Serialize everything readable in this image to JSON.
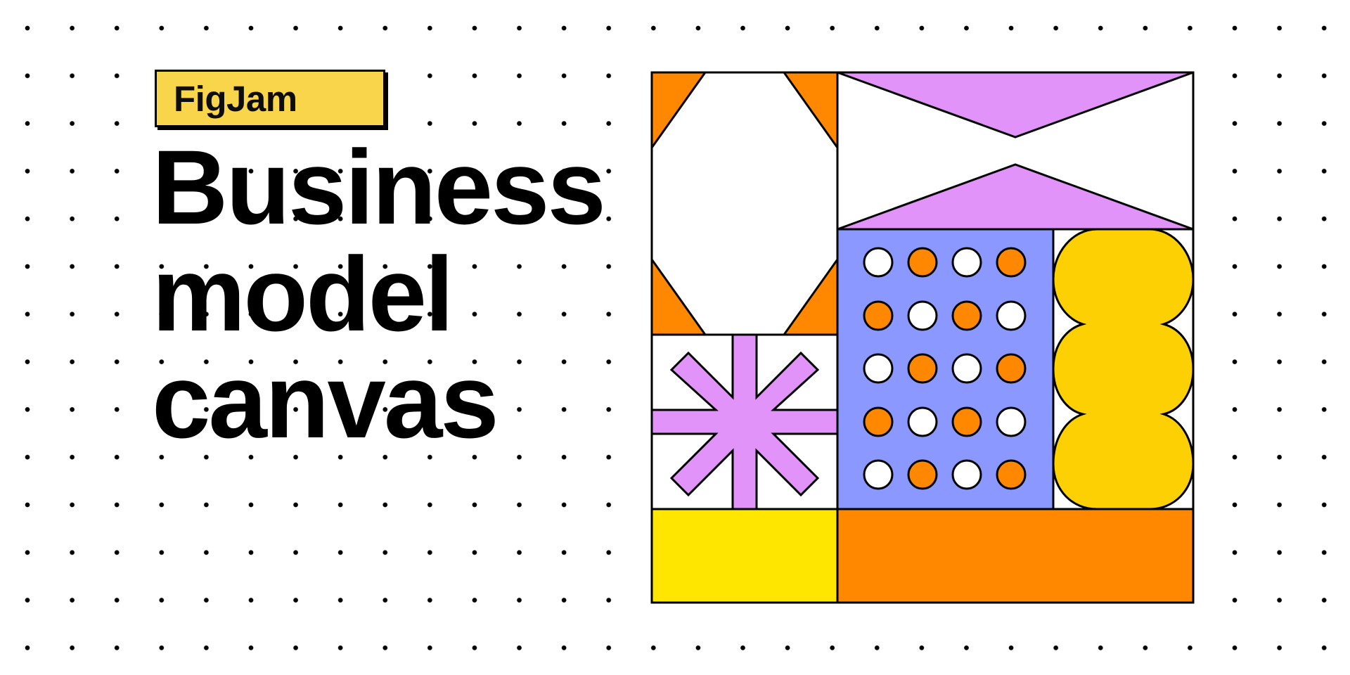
{
  "tag": {
    "label": "FigJam"
  },
  "headline": {
    "line1": "Business",
    "line2": "model",
    "line3": "canvas"
  },
  "colors": {
    "background": "#ffffff",
    "dots": "#000000",
    "tag_yellow": "#f8d54a",
    "orange": "#ff8800",
    "lilac": "#e193f9",
    "periwinkle": "#8b98ff",
    "gold": "#fdd003",
    "bright_yellow": "#ffe600",
    "ink": "#000000"
  },
  "illustration": {
    "panels": [
      "octagon-panel",
      "bowtie-panel",
      "asterisk-panel",
      "dot-grid-panel",
      "wavy-pill-panel",
      "yellow-block",
      "orange-block"
    ],
    "dot_grid": {
      "rows": 5,
      "columns": 4,
      "pattern": "alternating white and orange circles"
    }
  }
}
